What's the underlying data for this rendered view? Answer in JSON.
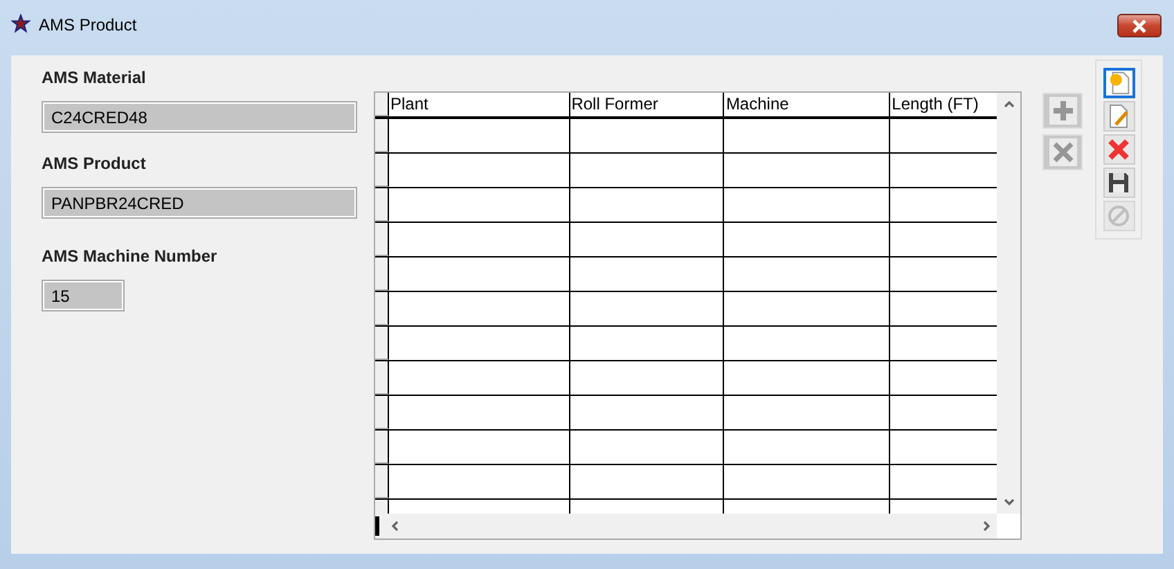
{
  "window": {
    "title": "AMS Product"
  },
  "fields": [
    {
      "label": "AMS Material",
      "value": "C24CRED48"
    },
    {
      "label": "AMS Product",
      "value": "PANPBR24CRED"
    },
    {
      "label": "AMS Machine Number",
      "value": "15"
    }
  ],
  "table": {
    "columns": [
      "Plant",
      "Roll Former",
      "Machine",
      "Length (FT)"
    ]
  },
  "row_buttons": [
    {
      "kind": "add",
      "disabled": true
    },
    {
      "kind": "remove",
      "disabled": true
    }
  ],
  "toolbar": [
    {
      "kind": "new",
      "selected": true,
      "disabled": false
    },
    {
      "kind": "edit",
      "selected": false,
      "disabled": false
    },
    {
      "kind": "delete",
      "selected": false,
      "disabled": false
    },
    {
      "kind": "save",
      "selected": false,
      "disabled": false
    },
    {
      "kind": "cancel",
      "selected": false,
      "disabled": true
    }
  ]
}
